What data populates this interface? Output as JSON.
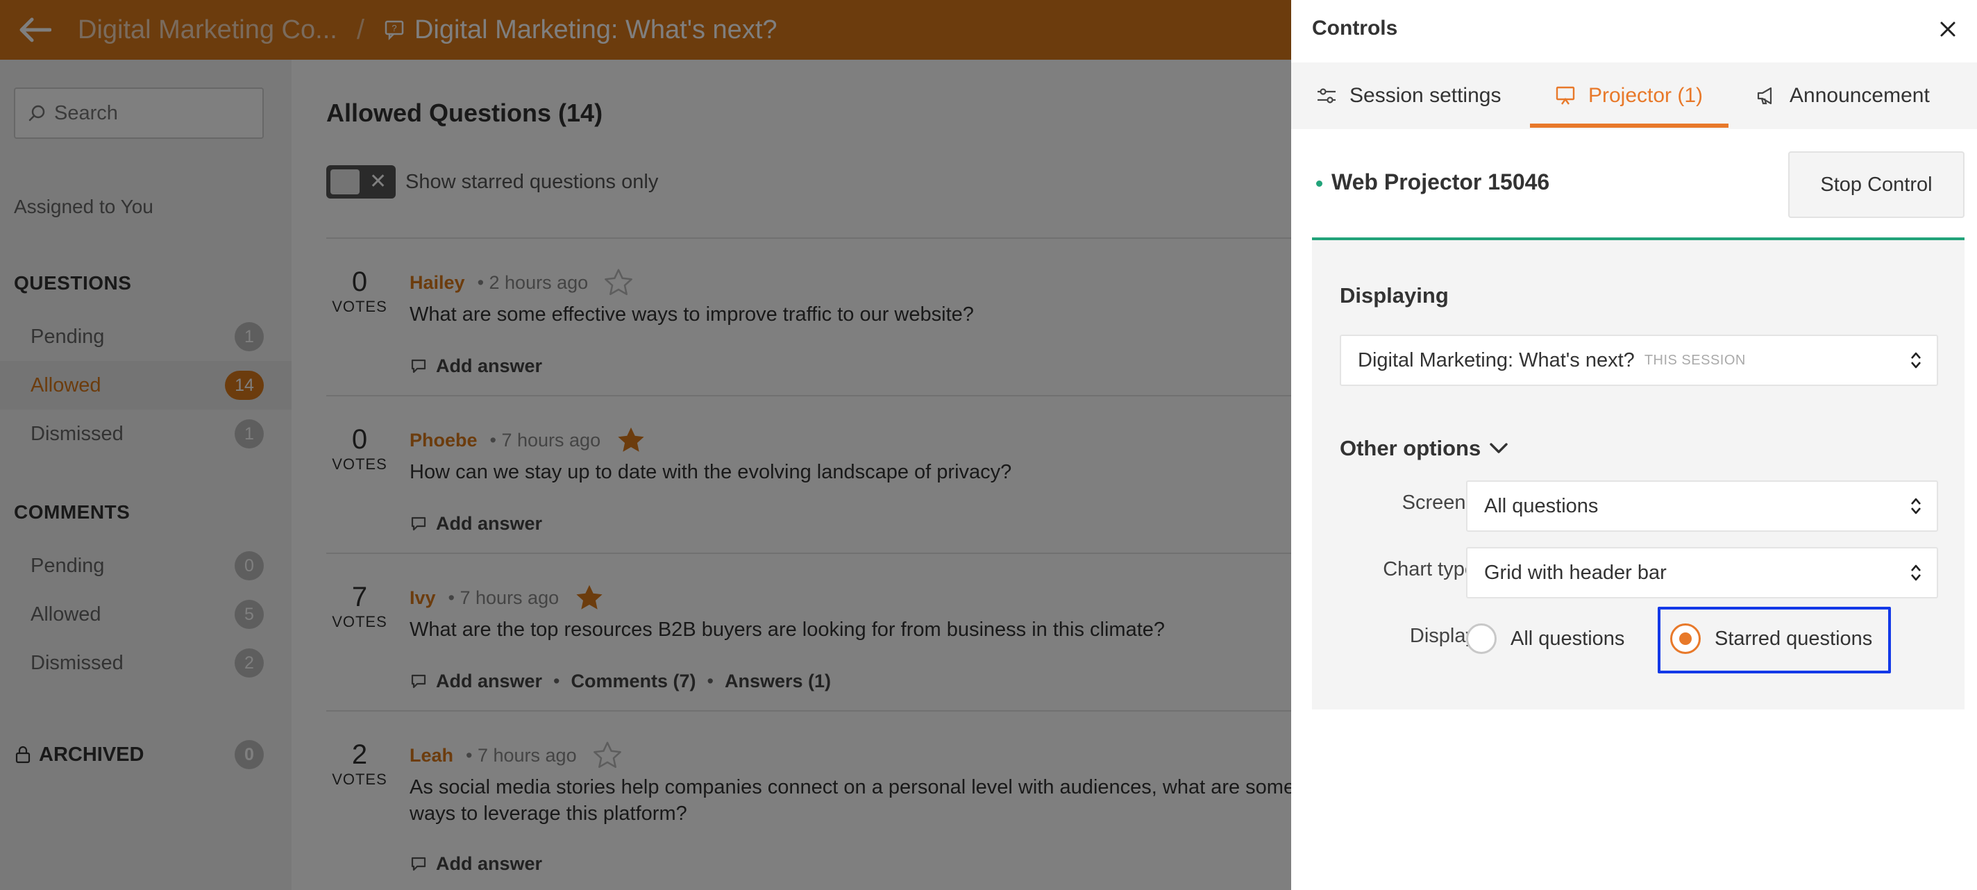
{
  "header": {
    "event_name": "Digital Marketing Co...",
    "separator": "/",
    "session_name": "Digital Marketing: What's next?"
  },
  "sidebar": {
    "search_placeholder": "Search",
    "assigned": "Assigned to You",
    "questions_heading": "QUESTIONS",
    "questions": [
      {
        "label": "Pending",
        "count": "1"
      },
      {
        "label": "Allowed",
        "count": "14"
      },
      {
        "label": "Dismissed",
        "count": "1"
      }
    ],
    "comments_heading": "COMMENTS",
    "comments": [
      {
        "label": "Pending",
        "count": "0"
      },
      {
        "label": "Allowed",
        "count": "5"
      },
      {
        "label": "Dismissed",
        "count": "2"
      }
    ],
    "archived_heading": "ARCHIVED",
    "archived_count": "0"
  },
  "main": {
    "title": "Allowed Questions (14)",
    "toggle_label": "Show starred questions only",
    "votes_label": "VOTES",
    "add_answer": "Add answer",
    "questions": [
      {
        "votes": "0",
        "author": "Hailey",
        "time": "• 2 hours ago",
        "text": "What are some effective ways to improve traffic to our website?"
      },
      {
        "votes": "0",
        "author": "Phoebe",
        "time": "• 7 hours ago",
        "text": "How can we stay up to date with the evolving landscape of privacy?"
      },
      {
        "votes": "7",
        "author": "Ivy",
        "time": "• 7 hours ago",
        "text": "What are the top resources B2B buyers are looking for from business in this climate?",
        "comments": "Comments (7)",
        "answers": "Answers (1)"
      },
      {
        "votes": "2",
        "author": "Leah",
        "time": "• 7 hours ago",
        "text": "As social media stories help companies connect on a personal level with audiences, what are some ways to leverage this platform?"
      }
    ]
  },
  "panel": {
    "title": "Controls",
    "tabs": {
      "session_settings": "Session settings",
      "projector": "Projector (1)",
      "announcement": "Announcement"
    },
    "projector_name": "Web Projector 15046",
    "stop_control": "Stop Control",
    "displaying_label": "Displaying",
    "displaying_value": "Digital Marketing: What's next?",
    "displaying_suffix": "THIS SESSION",
    "other_options": "Other options",
    "screens_label": "Screens",
    "screens_value": "All questions",
    "chart_type_label": "Chart type",
    "chart_type_value": "Grid with header bar",
    "display_label": "Display",
    "display_option_all": "All questions",
    "display_option_starred": "Starred questions"
  },
  "colors": {
    "brand_orange": "#d9781b",
    "tab_active": "#e8792a",
    "success_green": "#22a37a",
    "highlight_blue": "#1339e8"
  }
}
